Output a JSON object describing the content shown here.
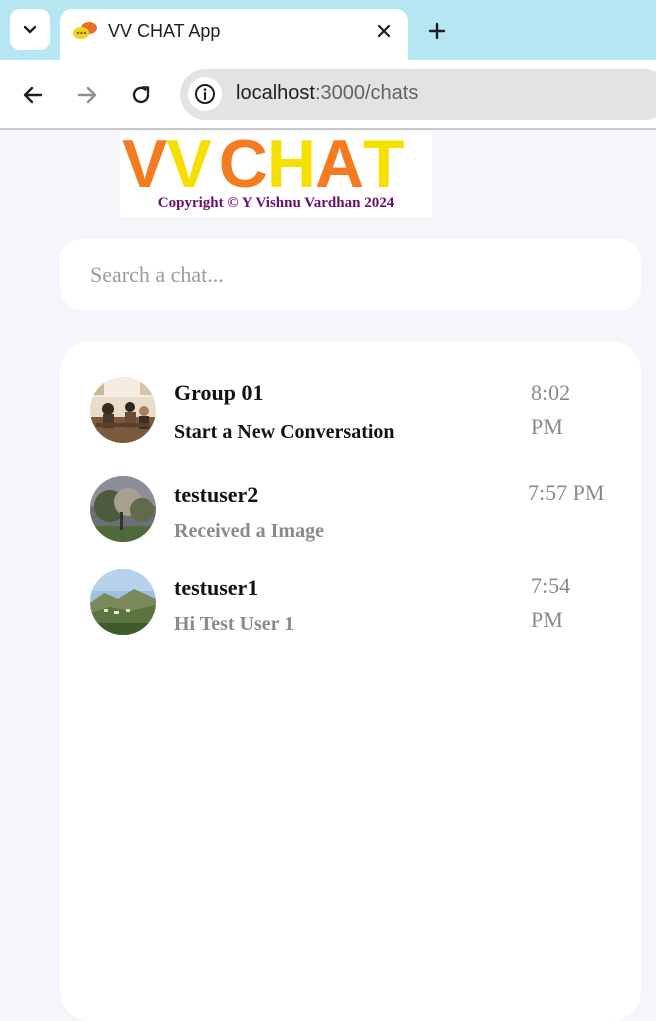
{
  "browser": {
    "tab_title": "VV CHAT App",
    "url_host": "localhost",
    "url_path": ":3000/chats",
    "icons": {
      "tab_menu": "chevron-down-icon",
      "favicon": "chat-bubbles-icon",
      "close": "close-icon",
      "new_tab": "plus-icon",
      "back": "arrow-left-icon",
      "forward": "arrow-right-icon",
      "reload": "reload-icon",
      "site_info": "info-icon"
    }
  },
  "logo": {
    "letters": [
      "V",
      "V",
      "C",
      "H",
      "A",
      "T"
    ],
    "colors": [
      "#f47b20",
      "#f5e000",
      "#f47b20",
      "#f5e000",
      "#f47b20",
      "#f5e000"
    ],
    "copyright": "Copyright © Y Vishnu Vardhan 2024"
  },
  "search": {
    "placeholder": "Search a chat..."
  },
  "chats": [
    {
      "name": "Group 01",
      "last_message": "Start a New Conversation",
      "time": "8:02 PM",
      "unread": true
    },
    {
      "name": "testuser2",
      "last_message": "Received a Image",
      "time": "7:57 PM",
      "unread": false
    },
    {
      "name": "testuser1",
      "last_message": "Hi Test User 1",
      "time": "7:54 PM",
      "unread": false
    }
  ]
}
